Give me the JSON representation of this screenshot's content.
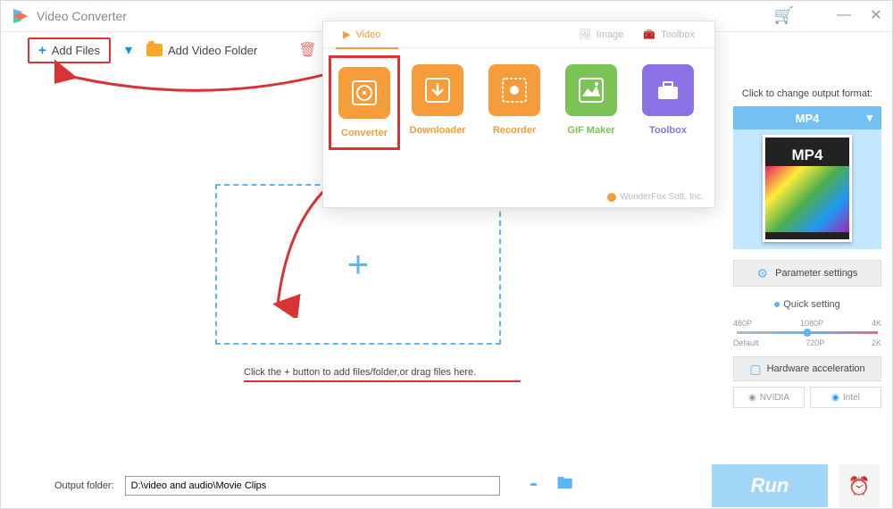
{
  "app": {
    "title": "Video Converter"
  },
  "toolbar": {
    "add_files": "Add Files",
    "add_folder": "Add Video Folder"
  },
  "popup": {
    "tabs": {
      "video": "Video",
      "image": "Image",
      "toolbox": "Toolbox"
    },
    "items": [
      {
        "label": "Converter",
        "color": "#f79c3a"
      },
      {
        "label": "Downloader",
        "color": "#f79c3a"
      },
      {
        "label": "Recorder",
        "color": "#f79c3a"
      },
      {
        "label": "GIF Maker",
        "color": "#7cc355"
      },
      {
        "label": "Toolbox",
        "color": "#8a72e6"
      }
    ],
    "footer": "WonderFox Soft, Inc."
  },
  "dropzone": {
    "hint": "Click the + button to add files/folder,or drag files here."
  },
  "sidebar": {
    "change_label": "Click to change output format:",
    "format": "MP4",
    "format_badge": "MP4",
    "param_settings": "Parameter settings",
    "quick_setting": "Quick setting",
    "slider_marks_top": [
      "480P",
      "1080P",
      "4K"
    ],
    "slider_marks_bottom": [
      "Default",
      "720P",
      "2K"
    ],
    "hw_accel": "Hardware acceleration",
    "gpu1": "NVIDIA",
    "gpu2": "Intel"
  },
  "bottombar": {
    "label": "Output folder:",
    "path": "D:\\video and audio\\Movie Clips",
    "run": "Run"
  }
}
